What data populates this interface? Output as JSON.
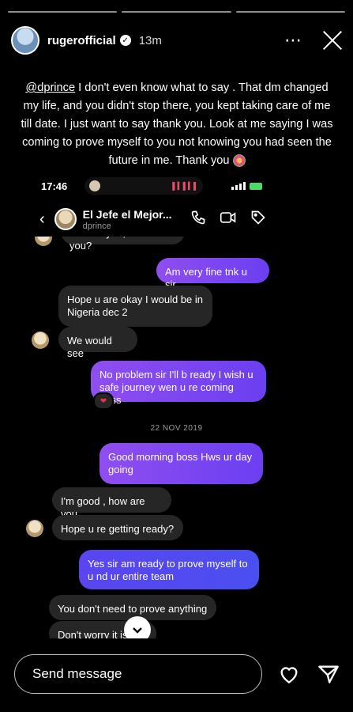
{
  "story": {
    "progress_segments": 3,
    "username": "rugerofficial",
    "verified_mark": "✓",
    "time_ago": "13m",
    "more_icon": "⋯",
    "caption_mention": "@dprince",
    "caption_text": " I don't even know what to say . That dm changed my life, and you didn't stop there, you kept taking care of me till date. I just want to say thank you. Look at me saying I was coming to prove myself to you not knowing you had seen the future in me. Thank you"
  },
  "phone_status": {
    "clock": "17:46"
  },
  "dm": {
    "name": "El Jefe el Mejor...",
    "handle": "dprince",
    "back_icon": "‹",
    "messages": [
      {
        "id": "m1",
        "side": "in",
        "text": "Hows it you, how are you?"
      },
      {
        "id": "m2",
        "side": "out",
        "text": "Am very fine tnk u sir"
      },
      {
        "id": "m3",
        "side": "in",
        "text": "Hope u are okay I would be in Nigeria dec 2"
      },
      {
        "id": "m4",
        "side": "in",
        "text": "We would see"
      },
      {
        "id": "m5",
        "side": "out",
        "text": "No problem sir I'll b ready I wish u safe journey wen u re coming boss"
      },
      {
        "id": "m6",
        "side": "out",
        "text": "Good morning boss Hws ur day going"
      },
      {
        "id": "m7",
        "side": "in",
        "text": "I'm good , how are you"
      },
      {
        "id": "m8",
        "side": "in",
        "text": "Hope u re getting ready?"
      },
      {
        "id": "m9",
        "side": "out",
        "text": "Yes sir am ready to prove myself to u nd ur entire team"
      },
      {
        "id": "m10",
        "side": "in",
        "text": "You don't need to prove anything"
      },
      {
        "id": "m11",
        "side": "in",
        "text": "Don't worry it is"
      }
    ],
    "date_separator": "22 NOV 2019",
    "reaction": "❤"
  },
  "reply": {
    "placeholder": "Send message"
  },
  "colors": {
    "outgoing_start": "#8f4ef0",
    "outgoing_end": "#4a4ff0",
    "incoming": "#262626",
    "background": "#000000"
  },
  "icons": [
    "close-icon",
    "more-icon",
    "phone-icon",
    "video-icon",
    "tag-icon",
    "heart-icon",
    "send-icon",
    "chevron-down-icon"
  ]
}
